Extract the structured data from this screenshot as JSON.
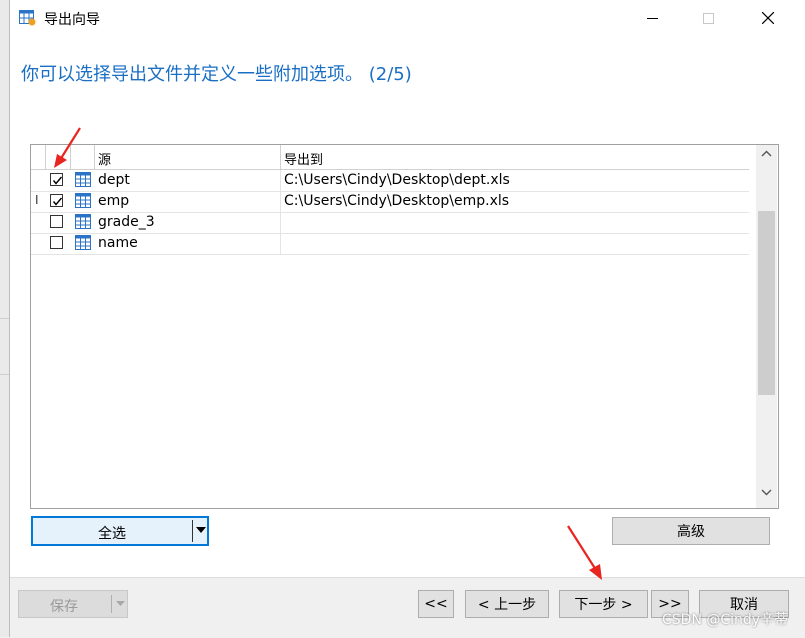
{
  "window": {
    "title": "导出向导",
    "heading": "你可以选择导出文件并定义一些附加选项。 (2/5)"
  },
  "grid": {
    "columns": [
      "源",
      "导出到"
    ],
    "rows": [
      {
        "checked": true,
        "indicator": "",
        "name": "dept",
        "path": "C:\\Users\\Cindy\\Desktop\\dept.xls"
      },
      {
        "checked": true,
        "indicator": "I",
        "name": "emp",
        "path": "C:\\Users\\Cindy\\Desktop\\emp.xls"
      },
      {
        "checked": false,
        "indicator": "",
        "name": "grade_3",
        "path": ""
      },
      {
        "checked": false,
        "indicator": "",
        "name": "name",
        "path": ""
      }
    ]
  },
  "buttons": {
    "select_all": "全选",
    "advanced": "高级",
    "save": "保存",
    "first": "<<",
    "prev": "< 上一步",
    "next": "下一步 >",
    "last": ">>",
    "cancel": "取消"
  },
  "watermark": "CSDN @Cindy辛蒂",
  "colors": {
    "heading": "#1a6fc4",
    "arrow": "#e8251f",
    "select_all_border": "#0078d7"
  }
}
